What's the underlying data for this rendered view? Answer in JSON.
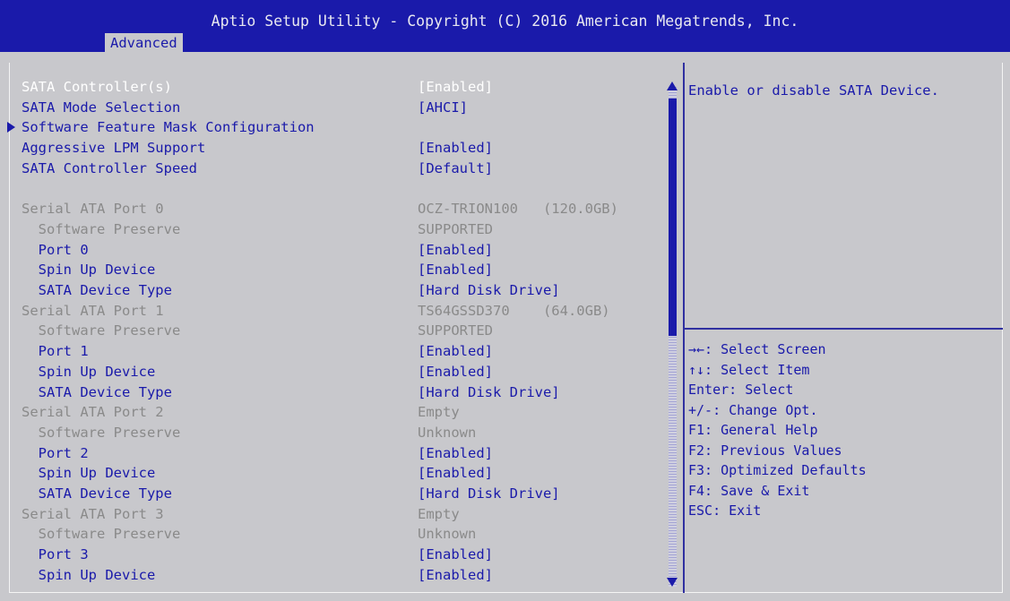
{
  "header": {
    "title": "Aptio Setup Utility - Copyright (C) 2016 American Megatrends, Inc.",
    "tab": "Advanced"
  },
  "items": [
    {
      "label": "SATA Controller(s)",
      "value": "[Enabled]",
      "state": "selected"
    },
    {
      "label": "SATA Mode Selection",
      "value": "[AHCI]",
      "state": "active"
    },
    {
      "label": "Software Feature Mask Configuration",
      "value": "",
      "state": "active",
      "submenu": true
    },
    {
      "label": "Aggressive LPM Support",
      "value": "[Enabled]",
      "state": "active"
    },
    {
      "label": "SATA Controller Speed",
      "value": "[Default]",
      "state": "active"
    },
    {
      "label": "",
      "value": "",
      "state": "blank"
    },
    {
      "label": "Serial ATA Port 0",
      "value": "OCZ-TRION100   (120.0GB)",
      "state": "disabled"
    },
    {
      "label": "  Software Preserve",
      "value": "SUPPORTED",
      "state": "disabled"
    },
    {
      "label": "  Port 0",
      "value": "[Enabled]",
      "state": "active"
    },
    {
      "label": "  Spin Up Device",
      "value": "[Enabled]",
      "state": "active"
    },
    {
      "label": "  SATA Device Type",
      "value": "[Hard Disk Drive]",
      "state": "active"
    },
    {
      "label": "Serial ATA Port 1",
      "value": "TS64GSSD370    (64.0GB)",
      "state": "disabled"
    },
    {
      "label": "  Software Preserve",
      "value": "SUPPORTED",
      "state": "disabled"
    },
    {
      "label": "  Port 1",
      "value": "[Enabled]",
      "state": "active"
    },
    {
      "label": "  Spin Up Device",
      "value": "[Enabled]",
      "state": "active"
    },
    {
      "label": "  SATA Device Type",
      "value": "[Hard Disk Drive]",
      "state": "active"
    },
    {
      "label": "Serial ATA Port 2",
      "value": "Empty",
      "state": "disabled"
    },
    {
      "label": "  Software Preserve",
      "value": "Unknown",
      "state": "disabled"
    },
    {
      "label": "  Port 2",
      "value": "[Enabled]",
      "state": "active"
    },
    {
      "label": "  Spin Up Device",
      "value": "[Enabled]",
      "state": "active"
    },
    {
      "label": "  SATA Device Type",
      "value": "[Hard Disk Drive]",
      "state": "active"
    },
    {
      "label": "Serial ATA Port 3",
      "value": "Empty",
      "state": "disabled"
    },
    {
      "label": "  Software Preserve",
      "value": "Unknown",
      "state": "disabled"
    },
    {
      "label": "  Port 3",
      "value": "[Enabled]",
      "state": "active"
    },
    {
      "label": "  Spin Up Device",
      "value": "[Enabled]",
      "state": "active"
    }
  ],
  "help": {
    "text": "Enable or disable SATA Device."
  },
  "keys": [
    "→←: Select Screen",
    "↑↓: Select Item",
    "Enter: Select",
    "+/-: Change Opt.",
    "F1: General Help",
    "F2: Previous Values",
    "F3: Optimized Defaults",
    "F4: Save & Exit",
    "ESC: Exit"
  ],
  "colors": {
    "title_bar": "#1a1aaa",
    "background": "#c8c8cc",
    "active_text": "#1a1aaa",
    "disabled_text": "#8a8a8a",
    "selected_text": "#ffffff"
  }
}
